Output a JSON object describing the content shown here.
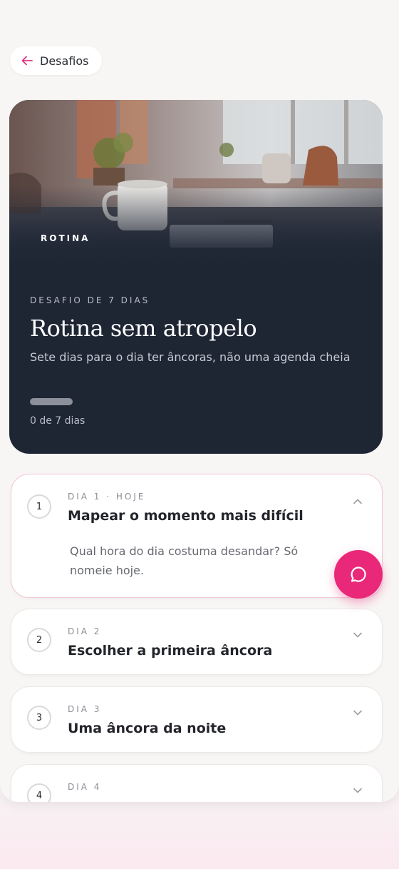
{
  "nav": {
    "back_label": "Desafios"
  },
  "hero": {
    "tag": "ROTINA",
    "kicker": "DESAFIO DE 7 DIAS",
    "title": "Rotina sem atropelo",
    "subtitle": "Sete dias para o dia ter âncoras, não uma agenda cheia",
    "progress_fraction": 0,
    "progress_text": "0 de 7 dias"
  },
  "days": [
    {
      "number": "1",
      "label": "DIA 1 · HOJE",
      "title": "Mapear o momento mais difícil",
      "description": "Qual hora do dia costuma desandar? Só nomeie hoje.",
      "expanded": true
    },
    {
      "number": "2",
      "label": "DIA 2",
      "title": "Escolher a primeira âncora",
      "expanded": false
    },
    {
      "number": "3",
      "label": "DIA 3",
      "title": "Uma âncora da noite",
      "expanded": false
    },
    {
      "number": "4",
      "label": "DIA 4",
      "title": "",
      "expanded": false
    }
  ],
  "fab": {
    "icon": "chat-bubble-icon"
  },
  "colors": {
    "accent": "#e9287a",
    "hero_bg": "#1e2634",
    "page_bg": "#f8f6f4"
  }
}
